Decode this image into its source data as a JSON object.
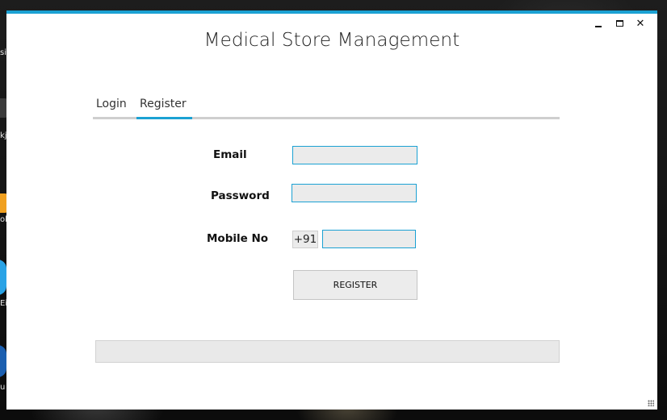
{
  "app": {
    "title": "Medical Store Management"
  },
  "window_controls": {
    "close_glyph": "✕"
  },
  "tabs": [
    {
      "label": "Login",
      "active": false
    },
    {
      "label": "Register",
      "active": true
    }
  ],
  "form": {
    "email_label": "Email",
    "email_value": "",
    "password_label": "Password",
    "password_value": "",
    "mobile_label": "Mobile No",
    "mobile_prefix": "+91",
    "mobile_value": ""
  },
  "register_button": {
    "label": "REGISTER"
  },
  "desktop": {
    "icon_labels": [
      "sit",
      "kj",
      "ok",
      "Ei",
      "u"
    ]
  },
  "colors": {
    "accent": "#1ba1d3",
    "window_bg": "#ffffff",
    "field_bg": "#ebebeb",
    "tab_rule": "#cfcfcf"
  },
  "icons": {
    "minimize": "minimize-icon",
    "maximize": "maximize-icon",
    "close": "close-icon",
    "resize_grip": "resize-grip-icon"
  }
}
